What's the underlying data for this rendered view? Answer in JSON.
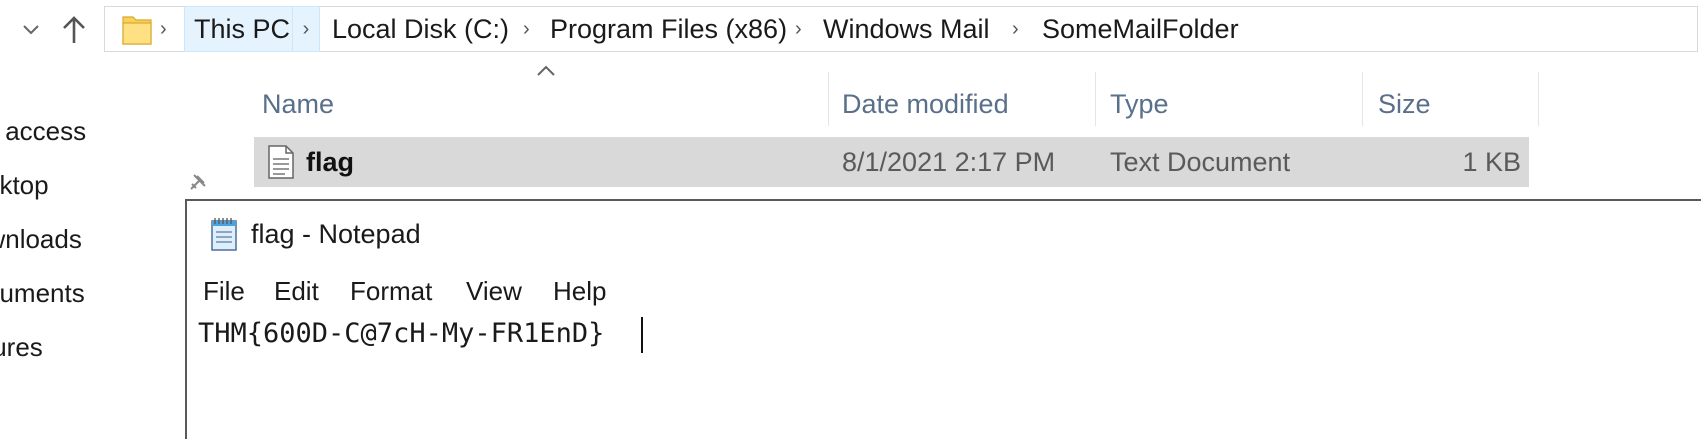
{
  "explorer": {
    "breadcrumbs": [
      "This PC",
      "Local Disk (C:)",
      "Program Files (x86)",
      "Windows Mail",
      "SomeMailFolder"
    ],
    "columns": {
      "name": "Name",
      "date": "Date modified",
      "type": "Type",
      "size": "Size"
    },
    "file": {
      "name": "flag",
      "date": "8/1/2021 2:17 PM",
      "type": "Text Document",
      "size": "1 KB"
    },
    "sidebar": [
      "ck access",
      "esktop",
      "ownloads",
      "ocuments",
      "ctures"
    ]
  },
  "notepad": {
    "title": "flag - Notepad",
    "menu": [
      "File",
      "Edit",
      "Format",
      "View",
      "Help"
    ],
    "content": "THM{600D-C@7cH-My-FR1EnD}"
  },
  "icons": [
    "chevron-down-icon",
    "up-arrow-icon",
    "folder-icon",
    "text-file-icon",
    "notepad-icon",
    "pin-icon"
  ]
}
